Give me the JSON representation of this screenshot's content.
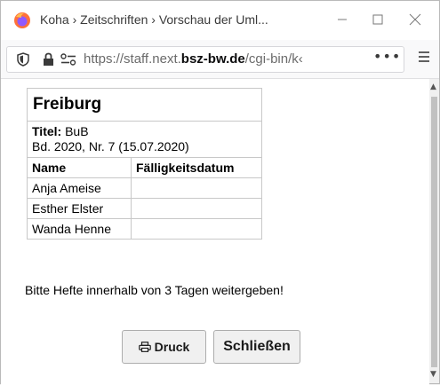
{
  "window": {
    "title": "Koha › Zeitschriften › Vorschau der Uml..."
  },
  "urlbar": {
    "url_prefix": "https://staff.next.",
    "url_domain": "bsz-bw.de",
    "url_suffix": "/cgi-bin/k‹",
    "page_actions": "•••"
  },
  "slip": {
    "library": "Freiburg",
    "title_label": "Titel:",
    "title_value": "BuB",
    "issue": "Bd. 2020, Nr. 7 (15.07.2020)",
    "columns": [
      "Name",
      "Fälligkeitsdatum"
    ],
    "rows": [
      {
        "name": "Anja Ameise",
        "due": ""
      },
      {
        "name": "Esther Elster",
        "due": ""
      },
      {
        "name": "Wanda Henne",
        "due": ""
      }
    ],
    "note": "Bitte Hefte innerhalb von 3 Tagen weitergeben!"
  },
  "buttons": {
    "print_label": "Druck",
    "close_label": "Schließen"
  },
  "colors": {
    "firefox_orange": "#ff7139",
    "firefox_purple": "#9059ff"
  }
}
